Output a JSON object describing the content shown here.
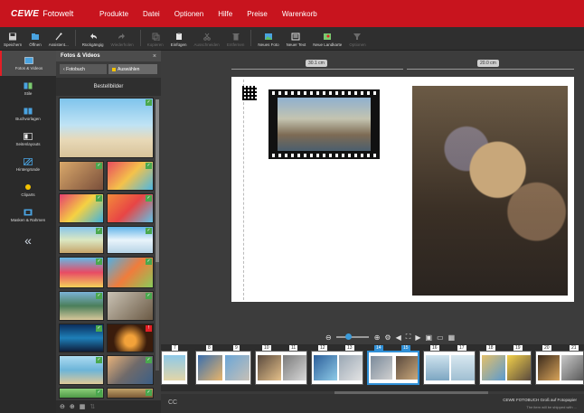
{
  "brand": {
    "logo": "CEWE",
    "product": "Fotowelt"
  },
  "menu": [
    "Produkte",
    "Datei",
    "Optionen",
    "Hilfe",
    "Preise",
    "Warenkorb"
  ],
  "toolbar": [
    {
      "label": "Speichern",
      "icon": "save-icon",
      "enabled": true
    },
    {
      "label": "Öffnen",
      "icon": "folder-open-icon",
      "enabled": true
    },
    {
      "label": "Assistent...",
      "icon": "magic-wand-icon",
      "enabled": true
    },
    {
      "label": "Rückgängig",
      "icon": "undo-icon",
      "enabled": true
    },
    {
      "label": "Wiederholen",
      "icon": "redo-icon",
      "enabled": false
    },
    {
      "label": "Kopieren",
      "icon": "copy-icon",
      "enabled": false
    },
    {
      "label": "Einfügen",
      "icon": "paste-icon",
      "enabled": true
    },
    {
      "label": "Ausschneiden",
      "icon": "cut-icon",
      "enabled": false
    },
    {
      "label": "Entfernen",
      "icon": "trash-icon",
      "enabled": false
    },
    {
      "label": "Neues Foto",
      "icon": "new-photo-icon",
      "enabled": true
    },
    {
      "label": "Neuer Text",
      "icon": "new-text-icon",
      "enabled": true
    },
    {
      "label": "Neue Landkarte",
      "icon": "new-map-icon",
      "enabled": true
    },
    {
      "label": "Optionen",
      "icon": "filter-icon",
      "enabled": false
    }
  ],
  "leftnav": [
    {
      "label": "Fotos & Videos",
      "icon": "photos-icon",
      "active": true
    },
    {
      "label": "Stile",
      "icon": "styles-icon",
      "active": false
    },
    {
      "label": "Buchvorlagen",
      "icon": "book-templates-icon",
      "active": false
    },
    {
      "label": "Seitenlayouts",
      "icon": "page-layouts-icon",
      "active": false
    },
    {
      "label": "Hintergründe",
      "icon": "backgrounds-icon",
      "active": false
    },
    {
      "label": "Cliparts",
      "icon": "cliparts-icon",
      "active": false
    },
    {
      "label": "Masken & Rahmen",
      "icon": "masks-frames-icon",
      "active": false
    }
  ],
  "leftnav_collapse": "«",
  "panel": {
    "title": "Fotos & Videos",
    "close": "×",
    "tab_back": "Fotobuch",
    "tab_select": "Auswählen",
    "section": "Bestellbilder"
  },
  "workspace": {
    "ruler_left": "30.1 cm",
    "ruler_right": "20.0 cm"
  },
  "zoom": {
    "minus": "⊖",
    "plus": "⊕",
    "level": 0.25
  },
  "filmstrip": {
    "pages": [
      "7",
      "8",
      "9",
      "10",
      "11",
      "12",
      "13",
      "14",
      "15",
      "16",
      "17",
      "18",
      "19",
      "20",
      "21"
    ],
    "active": [
      "14",
      "15"
    ]
  },
  "status": {
    "left": "CC",
    "right_line1": "CEWE FOTOBUCH Groß auf Fotopapier",
    "right_line2": "The item will be shipped with ..."
  },
  "colors": {
    "brand_red": "#c8141e",
    "accent_blue": "#2f8fd6",
    "check_green": "#4aa84e"
  }
}
